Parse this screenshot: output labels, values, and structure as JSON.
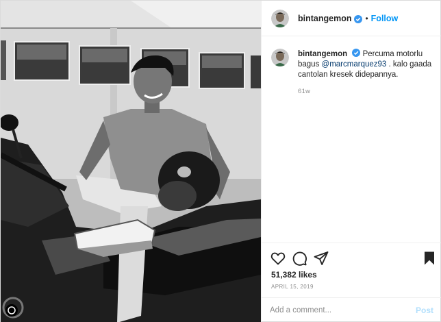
{
  "photo": {
    "alt_icon": "photo-of-young-man-on-motorcycle"
  },
  "header": {
    "username": "bintangemon",
    "separator": "•",
    "follow_label": "Follow",
    "verified_icon": "verified-badge-icon"
  },
  "caption": {
    "username": "bintangemon",
    "text_before": "Percuma motorlu bagus ",
    "mention": "@marcmarquez93",
    "text_after": " . kalo gaada cantolan kresek didepannya.",
    "time_ago": "61w"
  },
  "actions": {
    "like_icon": "heart-icon",
    "comment_icon": "comment-icon",
    "share_icon": "share-icon",
    "save_icon": "bookmark-icon"
  },
  "likes": "51,382 likes",
  "date": "APRIL 15, 2019",
  "comment": {
    "placeholder": "Add a comment...",
    "post_label": "Post"
  },
  "colors": {
    "link": "#0095f6",
    "mention": "#00376b",
    "muted": "#8e8e8e",
    "post_disabled": "#b2dffc",
    "verified": "#3897f0"
  }
}
